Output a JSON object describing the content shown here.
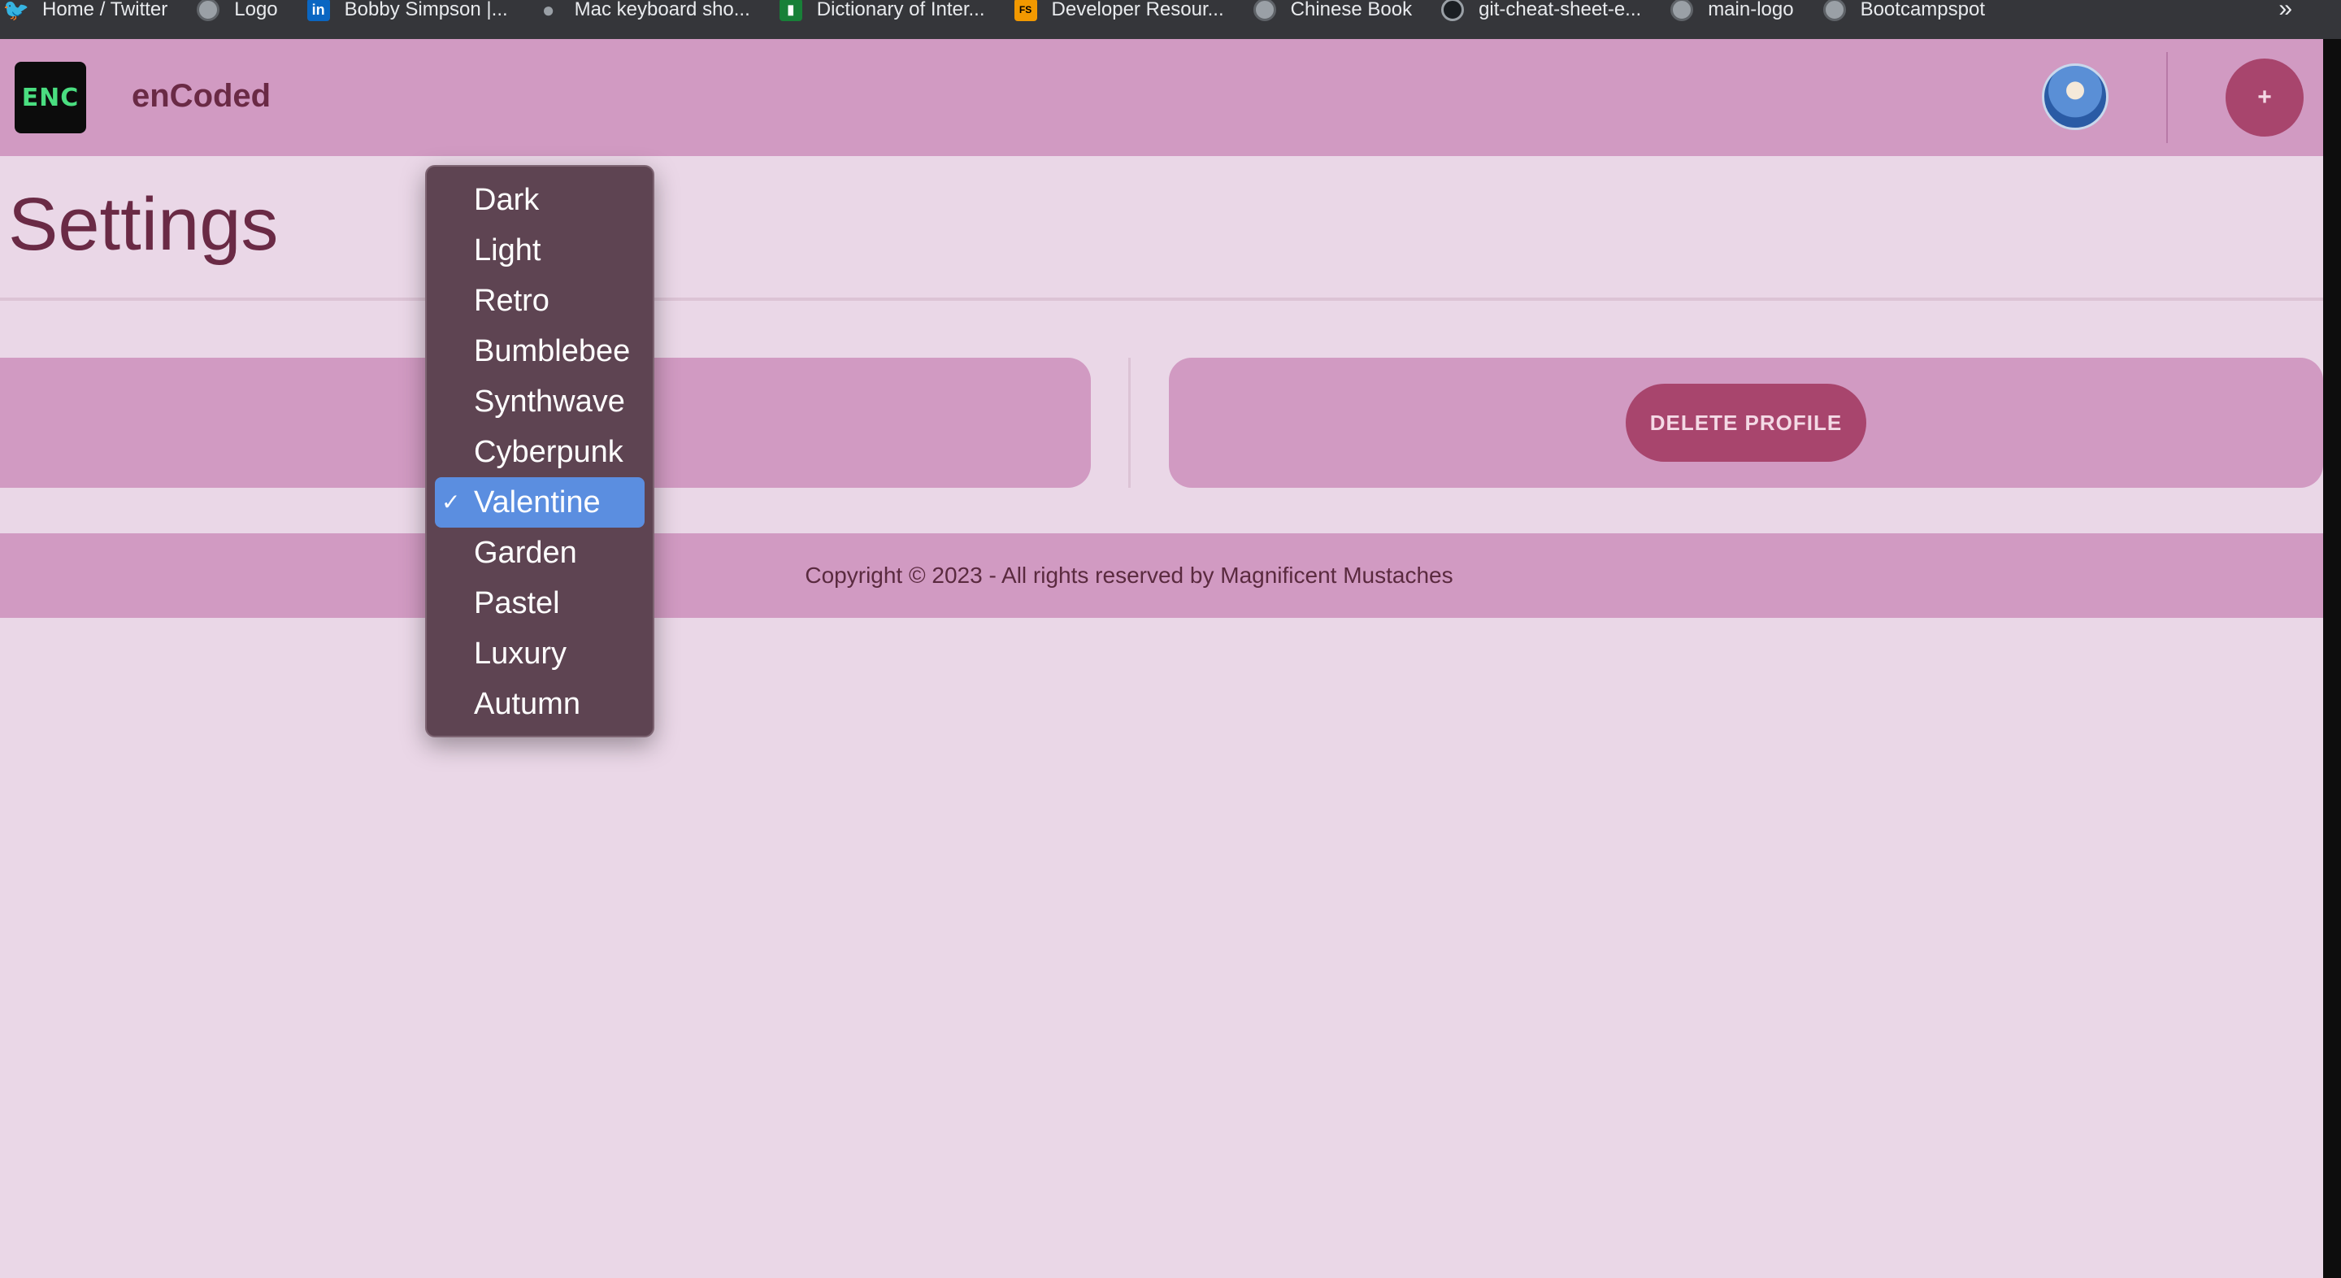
{
  "bookmarks": [
    {
      "label": "Home / Twitter",
      "icon": "twitter-icon"
    },
    {
      "label": "Logo",
      "icon": "globe-icon"
    },
    {
      "label": "Bobby Simpson |...",
      "icon": "linkedin-icon"
    },
    {
      "label": "Mac keyboard sho...",
      "icon": "apple-icon"
    },
    {
      "label": "Dictionary of Inter...",
      "icon": "book-icon"
    },
    {
      "label": "Developer Resour...",
      "icon": "fs-icon",
      "icon_text": "FS"
    },
    {
      "label": "Chinese Book",
      "icon": "globe-icon"
    },
    {
      "label": "git-cheat-sheet-e...",
      "icon": "github-icon"
    },
    {
      "label": "main-logo",
      "icon": "globe-icon"
    },
    {
      "label": "Bootcampspot",
      "icon": "globe-icon"
    }
  ],
  "bookmarks_more": "»",
  "navbar": {
    "logo_text": "ENC",
    "brand": "enCoded",
    "add_label": "+"
  },
  "page": {
    "title": "Settings",
    "delete_label": "DELETE PROFILE"
  },
  "theme_menu": {
    "options": [
      "Dark",
      "Light",
      "Retro",
      "Bumblebee",
      "Synthwave",
      "Cyberpunk",
      "Valentine",
      "Garden",
      "Pastel",
      "Luxury",
      "Autumn"
    ],
    "selected": "Valentine",
    "check": "✓"
  },
  "footer": {
    "text": "Copyright © 2023 - All rights reserved by Magnificent Mustaches"
  },
  "colors": {
    "page_bg": "#ead7e7",
    "navbar_bg": "#d19ac2",
    "accent": "#a8456d",
    "text": "#6a2a45",
    "menu_bg": "#5e4452",
    "menu_selected": "#5b8ee0"
  }
}
